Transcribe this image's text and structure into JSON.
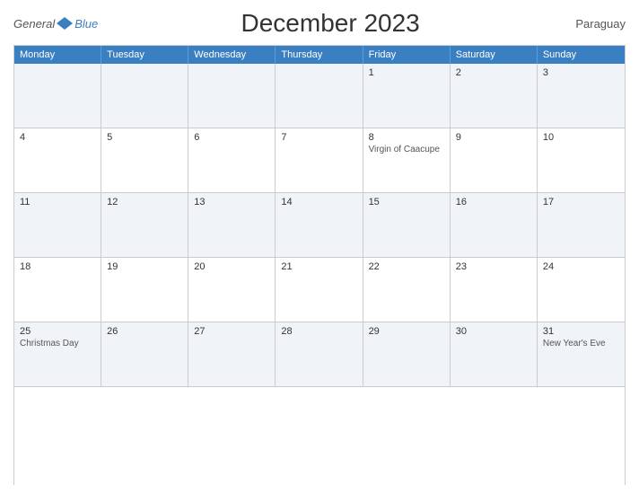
{
  "logo": {
    "general": "General",
    "blue": "Blue"
  },
  "header": {
    "title": "December 2023",
    "country": "Paraguay"
  },
  "days": [
    "Monday",
    "Tuesday",
    "Wednesday",
    "Thursday",
    "Friday",
    "Saturday",
    "Sunday"
  ],
  "weeks": [
    [
      {
        "date": "",
        "event": ""
      },
      {
        "date": "",
        "event": ""
      },
      {
        "date": "",
        "event": ""
      },
      {
        "date": "",
        "event": ""
      },
      {
        "date": "1",
        "event": ""
      },
      {
        "date": "2",
        "event": ""
      },
      {
        "date": "3",
        "event": ""
      }
    ],
    [
      {
        "date": "4",
        "event": ""
      },
      {
        "date": "5",
        "event": ""
      },
      {
        "date": "6",
        "event": ""
      },
      {
        "date": "7",
        "event": ""
      },
      {
        "date": "8",
        "event": "Virgin of Caacupe"
      },
      {
        "date": "9",
        "event": ""
      },
      {
        "date": "10",
        "event": ""
      }
    ],
    [
      {
        "date": "11",
        "event": ""
      },
      {
        "date": "12",
        "event": ""
      },
      {
        "date": "13",
        "event": ""
      },
      {
        "date": "14",
        "event": ""
      },
      {
        "date": "15",
        "event": ""
      },
      {
        "date": "16",
        "event": ""
      },
      {
        "date": "17",
        "event": ""
      }
    ],
    [
      {
        "date": "18",
        "event": ""
      },
      {
        "date": "19",
        "event": ""
      },
      {
        "date": "20",
        "event": ""
      },
      {
        "date": "21",
        "event": ""
      },
      {
        "date": "22",
        "event": ""
      },
      {
        "date": "23",
        "event": ""
      },
      {
        "date": "24",
        "event": ""
      }
    ],
    [
      {
        "date": "25",
        "event": "Christmas Day"
      },
      {
        "date": "26",
        "event": ""
      },
      {
        "date": "27",
        "event": ""
      },
      {
        "date": "28",
        "event": ""
      },
      {
        "date": "29",
        "event": ""
      },
      {
        "date": "30",
        "event": ""
      },
      {
        "date": "31",
        "event": "New Year's Eve"
      }
    ]
  ],
  "colors": {
    "header_bg": "#3a7fc1",
    "alt_row": "#f0f4f8",
    "border": "#ccc"
  }
}
